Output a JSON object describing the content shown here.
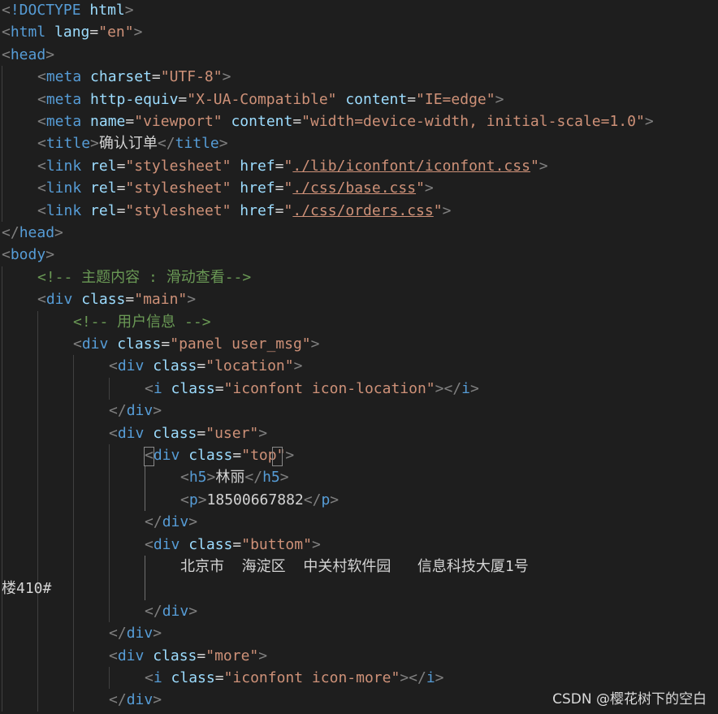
{
  "editor": {
    "lines": [
      {
        "indent": 0,
        "tokens": [
          [
            "br",
            "<"
          ],
          [
            "kw",
            "!DOCTYPE"
          ],
          [
            "tx",
            " "
          ],
          [
            "at",
            "html"
          ],
          [
            "br",
            ">"
          ]
        ]
      },
      {
        "indent": 0,
        "tokens": [
          [
            "br",
            "<"
          ],
          [
            "tag",
            "html"
          ],
          [
            "tx",
            " "
          ],
          [
            "at",
            "lang"
          ],
          [
            "tx",
            "="
          ],
          [
            "str",
            "\"en\""
          ],
          [
            "br",
            ">"
          ]
        ]
      },
      {
        "indent": 0,
        "tokens": [
          [
            "br",
            "<"
          ],
          [
            "tag",
            "head"
          ],
          [
            "br",
            ">"
          ]
        ]
      },
      {
        "indent": 1,
        "tokens": [
          [
            "br",
            "<"
          ],
          [
            "tag",
            "meta"
          ],
          [
            "tx",
            " "
          ],
          [
            "at",
            "charset"
          ],
          [
            "tx",
            "="
          ],
          [
            "str",
            "\"UTF-8\""
          ],
          [
            "br",
            ">"
          ]
        ]
      },
      {
        "indent": 1,
        "tokens": [
          [
            "br",
            "<"
          ],
          [
            "tag",
            "meta"
          ],
          [
            "tx",
            " "
          ],
          [
            "at",
            "http-equiv"
          ],
          [
            "tx",
            "="
          ],
          [
            "str",
            "\"X-UA-Compatible\""
          ],
          [
            "tx",
            " "
          ],
          [
            "at",
            "content"
          ],
          [
            "tx",
            "="
          ],
          [
            "str",
            "\"IE=edge\""
          ],
          [
            "br",
            ">"
          ]
        ]
      },
      {
        "indent": 1,
        "tokens": [
          [
            "br",
            "<"
          ],
          [
            "tag",
            "meta"
          ],
          [
            "tx",
            " "
          ],
          [
            "at",
            "name"
          ],
          [
            "tx",
            "="
          ],
          [
            "str",
            "\"viewport\""
          ],
          [
            "tx",
            " "
          ],
          [
            "at",
            "content"
          ],
          [
            "tx",
            "="
          ],
          [
            "str",
            "\"width=device-width, initial-scale=1.0\""
          ],
          [
            "br",
            ">"
          ]
        ]
      },
      {
        "indent": 1,
        "tokens": [
          [
            "br",
            "<"
          ],
          [
            "tag",
            "title"
          ],
          [
            "br",
            ">"
          ],
          [
            "tx",
            "确认订单"
          ],
          [
            "br",
            "</"
          ],
          [
            "tag",
            "title"
          ],
          [
            "br",
            ">"
          ]
        ]
      },
      {
        "indent": 1,
        "tokens": [
          [
            "br",
            "<"
          ],
          [
            "tag",
            "link"
          ],
          [
            "tx",
            " "
          ],
          [
            "at",
            "rel"
          ],
          [
            "tx",
            "="
          ],
          [
            "str",
            "\"stylesheet\""
          ],
          [
            "tx",
            " "
          ],
          [
            "at",
            "href"
          ],
          [
            "tx",
            "="
          ],
          [
            "str",
            "\""
          ],
          [
            "str link-u",
            "./lib/iconfont/iconfont.css"
          ],
          [
            "str",
            "\""
          ],
          [
            "br",
            ">"
          ]
        ]
      },
      {
        "indent": 1,
        "tokens": [
          [
            "br",
            "<"
          ],
          [
            "tag",
            "link"
          ],
          [
            "tx",
            " "
          ],
          [
            "at",
            "rel"
          ],
          [
            "tx",
            "="
          ],
          [
            "str",
            "\"stylesheet\""
          ],
          [
            "tx",
            " "
          ],
          [
            "at",
            "href"
          ],
          [
            "tx",
            "="
          ],
          [
            "str",
            "\""
          ],
          [
            "str link-u",
            "./css/base.css"
          ],
          [
            "str",
            "\""
          ],
          [
            "br",
            ">"
          ]
        ]
      },
      {
        "indent": 1,
        "tokens": [
          [
            "br",
            "<"
          ],
          [
            "tag",
            "link"
          ],
          [
            "tx",
            " "
          ],
          [
            "at",
            "rel"
          ],
          [
            "tx",
            "="
          ],
          [
            "str",
            "\"stylesheet\""
          ],
          [
            "tx",
            " "
          ],
          [
            "at",
            "href"
          ],
          [
            "tx",
            "="
          ],
          [
            "str",
            "\""
          ],
          [
            "str link-u",
            "./css/orders.css"
          ],
          [
            "str",
            "\""
          ],
          [
            "br",
            ">"
          ]
        ]
      },
      {
        "indent": 0,
        "tokens": [
          [
            "br",
            "</"
          ],
          [
            "tag",
            "head"
          ],
          [
            "br",
            ">"
          ]
        ]
      },
      {
        "indent": 0,
        "tokens": [
          [
            "br",
            "<"
          ],
          [
            "tag",
            "body"
          ],
          [
            "br",
            ">"
          ]
        ]
      },
      {
        "indent": 1,
        "tokens": [
          [
            "cm",
            "<!-- 主题内容 : 滑动查看-->"
          ]
        ]
      },
      {
        "indent": 1,
        "tokens": [
          [
            "br",
            "<"
          ],
          [
            "tag",
            "div"
          ],
          [
            "tx",
            " "
          ],
          [
            "at",
            "class"
          ],
          [
            "tx",
            "="
          ],
          [
            "str",
            "\"main\""
          ],
          [
            "br",
            ">"
          ]
        ]
      },
      {
        "indent": 2,
        "tokens": [
          [
            "cm",
            "<!-- 用户信息 -->"
          ]
        ]
      },
      {
        "indent": 2,
        "tokens": [
          [
            "br",
            "<"
          ],
          [
            "tag",
            "div"
          ],
          [
            "tx",
            " "
          ],
          [
            "at",
            "class"
          ],
          [
            "tx",
            "="
          ],
          [
            "str",
            "\"panel user_msg\""
          ],
          [
            "br",
            ">"
          ]
        ]
      },
      {
        "indent": 3,
        "tokens": [
          [
            "br",
            "<"
          ],
          [
            "tag",
            "div"
          ],
          [
            "tx",
            " "
          ],
          [
            "at",
            "class"
          ],
          [
            "tx",
            "="
          ],
          [
            "str",
            "\"location\""
          ],
          [
            "br",
            ">"
          ]
        ]
      },
      {
        "indent": 4,
        "tokens": [
          [
            "br",
            "<"
          ],
          [
            "tag",
            "i"
          ],
          [
            "tx",
            " "
          ],
          [
            "at",
            "class"
          ],
          [
            "tx",
            "="
          ],
          [
            "str",
            "\"iconfont icon-location\""
          ],
          [
            "br",
            "></"
          ],
          [
            "tag",
            "i"
          ],
          [
            "br",
            ">"
          ]
        ]
      },
      {
        "indent": 3,
        "tokens": [
          [
            "br",
            "</"
          ],
          [
            "tag",
            "div"
          ],
          [
            "br",
            ">"
          ]
        ]
      },
      {
        "indent": 3,
        "tokens": [
          [
            "br",
            "<"
          ],
          [
            "tag",
            "div"
          ],
          [
            "tx",
            " "
          ],
          [
            "at",
            "class"
          ],
          [
            "tx",
            "="
          ],
          [
            "str",
            "\"user\""
          ],
          [
            "br",
            ">"
          ]
        ]
      },
      {
        "indent": 4,
        "tokens": [
          [
            "br",
            "<"
          ],
          [
            "tag",
            "div"
          ],
          [
            "tx",
            " "
          ],
          [
            "at",
            "class"
          ],
          [
            "tx",
            "="
          ],
          [
            "str",
            "\"top\""
          ],
          [
            "br",
            ">"
          ]
        ]
      },
      {
        "indent": 5,
        "tokens": [
          [
            "br",
            "<"
          ],
          [
            "tag",
            "h5"
          ],
          [
            "br",
            ">"
          ],
          [
            "tx",
            "林丽"
          ],
          [
            "br",
            "</"
          ],
          [
            "tag",
            "h5"
          ],
          [
            "br",
            ">"
          ]
        ]
      },
      {
        "indent": 5,
        "tokens": [
          [
            "br",
            "<"
          ],
          [
            "tag",
            "p"
          ],
          [
            "br",
            ">"
          ],
          [
            "tx",
            "18500667882"
          ],
          [
            "br",
            "</"
          ],
          [
            "tag",
            "p"
          ],
          [
            "br",
            ">"
          ]
        ]
      },
      {
        "indent": 4,
        "tokens": [
          [
            "br",
            "</"
          ],
          [
            "tag",
            "div"
          ],
          [
            "br",
            ">"
          ]
        ]
      },
      {
        "indent": 4,
        "tokens": [
          [
            "br",
            "<"
          ],
          [
            "tag",
            "div"
          ],
          [
            "tx",
            " "
          ],
          [
            "at",
            "class"
          ],
          [
            "tx",
            "="
          ],
          [
            "str",
            "\"buttom\""
          ],
          [
            "br",
            ">"
          ]
        ]
      },
      {
        "indent": 5,
        "tokens": [
          [
            "tx",
            "北京市  海淀区  中关村软件园   信息科技大厦1号"
          ]
        ]
      },
      {
        "indent": 0,
        "tokens": [
          [
            "tx",
            "楼410#"
          ]
        ]
      },
      {
        "indent": 4,
        "tokens": [
          [
            "br",
            "</"
          ],
          [
            "tag",
            "div"
          ],
          [
            "br",
            ">"
          ]
        ]
      },
      {
        "indent": 3,
        "tokens": [
          [
            "br",
            "</"
          ],
          [
            "tag",
            "div"
          ],
          [
            "br",
            ">"
          ]
        ]
      },
      {
        "indent": 3,
        "tokens": [
          [
            "br",
            "<"
          ],
          [
            "tag",
            "div"
          ],
          [
            "tx",
            " "
          ],
          [
            "at",
            "class"
          ],
          [
            "tx",
            "="
          ],
          [
            "str",
            "\"more\""
          ],
          [
            "br",
            ">"
          ]
        ]
      },
      {
        "indent": 4,
        "tokens": [
          [
            "br",
            "<"
          ],
          [
            "tag",
            "i"
          ],
          [
            "tx",
            " "
          ],
          [
            "at",
            "class"
          ],
          [
            "tx",
            "="
          ],
          [
            "str",
            "\"iconfont icon-more\""
          ],
          [
            "br",
            "></"
          ],
          [
            "tag",
            "i"
          ],
          [
            "br",
            ">"
          ]
        ]
      },
      {
        "indent": 3,
        "tokens": [
          [
            "br",
            "</"
          ],
          [
            "tag",
            "div"
          ],
          [
            "br",
            ">"
          ]
        ]
      }
    ]
  },
  "watermark": "CSDN @樱花树下的空白"
}
